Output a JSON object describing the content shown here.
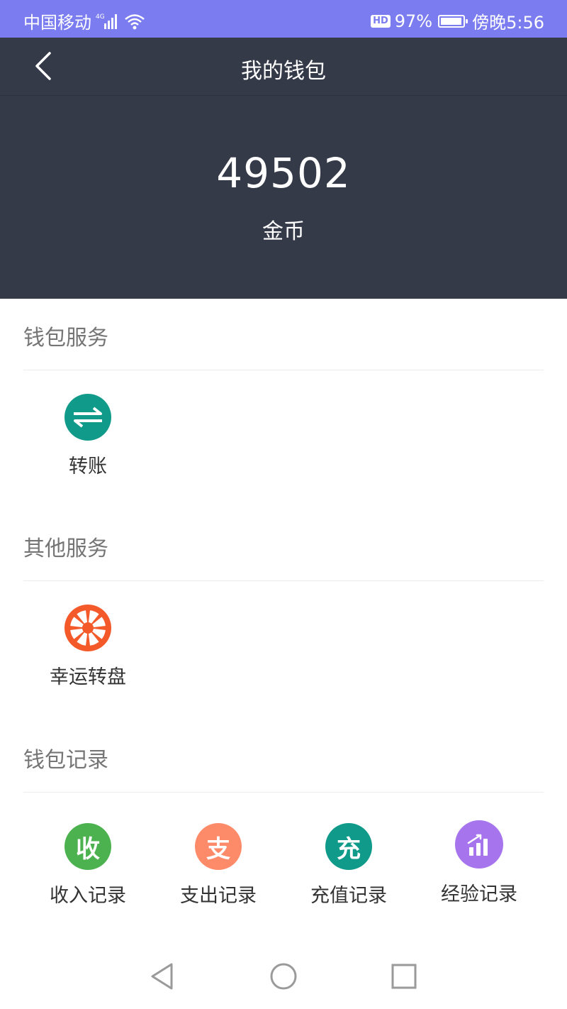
{
  "status_bar": {
    "carrier": "中国移动",
    "network": "4G",
    "battery_percent": "97%",
    "battery_level": 0.97,
    "time": "傍晚5:56",
    "hd_badge": "HD"
  },
  "header": {
    "title": "我的钱包",
    "back_icon": "chevron-left-icon"
  },
  "balance": {
    "amount": "49502",
    "unit": "金币"
  },
  "sections": {
    "wallet_services": {
      "title": "钱包服务",
      "items": [
        {
          "label": "转账",
          "icon": "transfer-arrows-icon",
          "color": "#109a8a"
        }
      ]
    },
    "other_services": {
      "title": "其他服务",
      "items": [
        {
          "label": "幸运转盘",
          "icon": "wheel-icon",
          "color": "#f4592a"
        }
      ]
    },
    "wallet_records": {
      "title": "钱包记录",
      "items": [
        {
          "label": "收入记录",
          "icon_char": "收",
          "color": "#4bb24f"
        },
        {
          "label": "支出记录",
          "icon_char": "支",
          "color": "#fd8b6a"
        },
        {
          "label": "充值记录",
          "icon_char": "充",
          "color": "#109a8a"
        },
        {
          "label": "经验记录",
          "icon": "bar-chart-icon",
          "color": "#a675ed"
        }
      ]
    }
  },
  "colors": {
    "status_bar_bg": "#7a7cf0",
    "header_bg": "#353a48"
  }
}
